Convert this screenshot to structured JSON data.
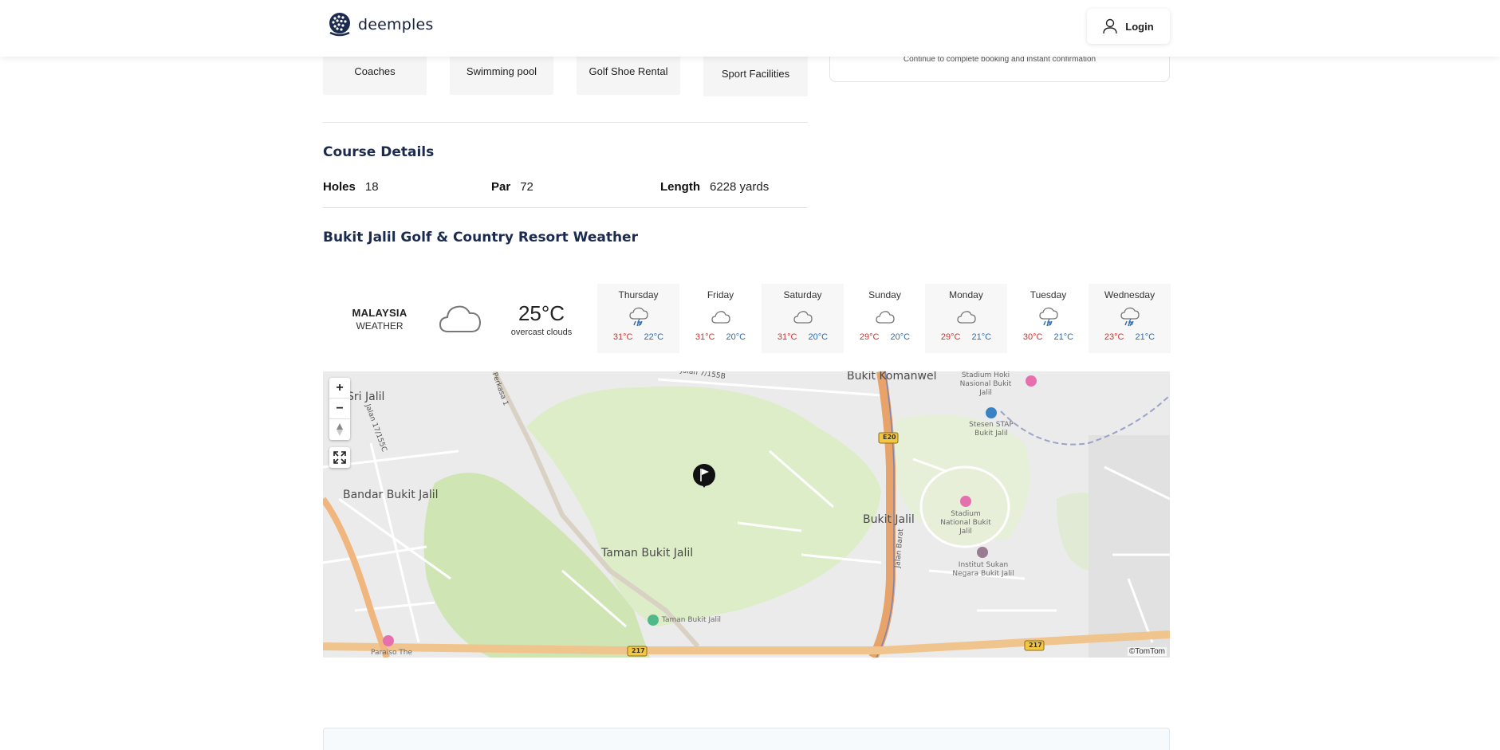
{
  "header": {
    "brand": "deemples",
    "login_label": "Login"
  },
  "booking": {
    "note": "Continue to complete booking and instant confirmation"
  },
  "facilities": [
    "Coaches",
    "Swimming pool",
    "Golf Shoe Rental",
    "Sport Facilities"
  ],
  "course_details": {
    "title": "Course Details",
    "holes_label": "Holes",
    "holes_value": "18",
    "par_label": "Par",
    "par_value": "72",
    "length_label": "Length",
    "length_value": "6228 yards"
  },
  "weather": {
    "title": "Bukit Jalil Golf & Country Resort Weather",
    "country": "MALAYSIA",
    "country_sub": "WEATHER",
    "current_temp": "25°C",
    "current_desc": "overcast clouds",
    "current_icon": "cloud-icon",
    "days": [
      {
        "name": "Thursday",
        "icon": "rain-cloud-icon",
        "high": "31°C",
        "low": "22°C"
      },
      {
        "name": "Friday",
        "icon": "cloud-icon",
        "high": "31°C",
        "low": "20°C"
      },
      {
        "name": "Saturday",
        "icon": "cloud-icon",
        "high": "31°C",
        "low": "20°C"
      },
      {
        "name": "Sunday",
        "icon": "cloud-icon",
        "high": "29°C",
        "low": "20°C"
      },
      {
        "name": "Monday",
        "icon": "cloud-icon",
        "high": "29°C",
        "low": "21°C"
      },
      {
        "name": "Tuesday",
        "icon": "rain-cloud-icon",
        "high": "30°C",
        "low": "21°C"
      },
      {
        "name": "Wednesday",
        "icon": "rain-cloud-icon",
        "high": "23°C",
        "low": "21°C"
      }
    ],
    "colors": {
      "high": "#d0312d",
      "low": "#2b6cb0"
    }
  },
  "map": {
    "attribution": "©TomTom",
    "zoom_in": "+",
    "zoom_out": "−",
    "labels": {
      "bukit_komanwel": "Bukit Komanwel",
      "bandar_bukit_jalil": "Bandar Bukit Jalil",
      "taman_bukit_jalil": "Taman Bukit Jalil",
      "bukit_jalil": "Bukit Jalil",
      "sri_jalil": "Sri Jalil",
      "stadium_hoki": "Stadium Hoki Nasional Bukit Jalil",
      "stesen_stap": "Stesen STAP Bukit Jalil",
      "stadium_national": "Stadium National Bukit Jalil",
      "institut_sukan": "Institut Sukan Negara Bukit Jalil",
      "taman_bukit_jalil_poi": "Taman Bukit Jalil",
      "paraiso": "Paraiso The",
      "jalan_17_155c": "Jalan 17/155C",
      "jalan_7_155b": "Jalan 7/155B",
      "perkasa": "Perkasa 1",
      "jalan_barat": "Jalan Barat",
      "e20": "E20",
      "r217a": "217",
      "r217b": "217"
    }
  }
}
